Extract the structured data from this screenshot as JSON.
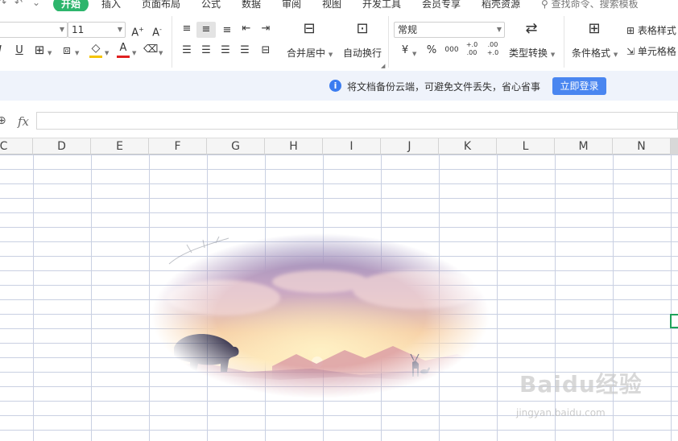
{
  "menu": {
    "tabs": [
      "开始",
      "插入",
      "页面布局",
      "公式",
      "数据",
      "审阅",
      "视图",
      "开发工具",
      "会员专享",
      "稻壳资源"
    ],
    "active_tab": "开始",
    "search_placeholder": "查找命令、搜索模板"
  },
  "ribbon": {
    "font_size": "11",
    "number_format": "常规",
    "merge_label": "合并居中",
    "wrap_label": "自动换行",
    "type_convert_label": "类型转换",
    "cond_format_label": "条件格式",
    "table_style_label": "表格样式",
    "cell_format_label": "单元格格",
    "currency_symbol": "¥",
    "percent_symbol": "%",
    "thousands_symbol": "000",
    "inc_decimal": "+.0 .00",
    "dec_decimal": ".00 +.0",
    "font_color": "#e02020",
    "fill_color": "#f5c400"
  },
  "notification": {
    "text": "将文档备份云端，可避免文件丢失，省心省事",
    "button": "立即登录",
    "accent": "#4a86f0"
  },
  "formula_bar": {
    "fx_label": "fx",
    "value": ""
  },
  "columns": [
    "C",
    "D",
    "E",
    "F",
    "G",
    "H",
    "I",
    "J",
    "K",
    "L",
    "M",
    "N"
  ],
  "watermark": {
    "logo": "Baidu经验",
    "url": "jingyan.baidu.com"
  },
  "colors": {
    "brand_green": "#2db56c",
    "grid_line": "#c9d0e2",
    "selection_green": "#1fa35a"
  }
}
